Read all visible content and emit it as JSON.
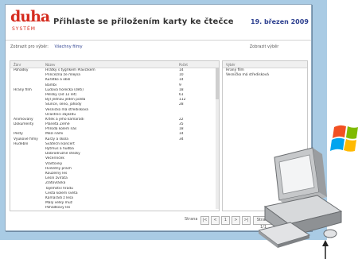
{
  "header": {
    "logo_text": "duha",
    "logo_sub": "SYSTÉM",
    "title": "Přihlaste se přiložením karty ke čtečce",
    "date": "19. březen 2009"
  },
  "toolbar": {
    "left_label": "Zobrazit pro výběr:",
    "left_link": "Všechny filmy",
    "right_label": "Zobrazit výběr"
  },
  "table": {
    "headers": {
      "genre": "Žánr",
      "title": "Název",
      "count": "Počet"
    },
    "rows": [
      {
        "genre": "Pohádky",
        "title": "Hrátky s tygříkem Plavčíkem",
        "count": "14"
      },
      {
        "genre": "",
        "title": "Princezna ze mlejna",
        "count": "10"
      },
      {
        "genre": "",
        "title": "Kuřátko a obilí",
        "count": "14"
      },
      {
        "genre": "",
        "title": "Bambi",
        "count": "9"
      },
      {
        "genre": "Hraný film",
        "title": "Ludová horečka (děti)",
        "count": "18"
      },
      {
        "genre": "",
        "title": "Pelíšky (od 12 let)",
        "count": "61"
      },
      {
        "genre": "",
        "title": "Byl jednou jeden polda",
        "count": "112"
      },
      {
        "genre": "",
        "title": "Slunce, seno, jahody",
        "count": "28"
      },
      {
        "genre": "",
        "title": "Vesničko má středisková",
        "count": ""
      },
      {
        "genre": "",
        "title": "Účastníci zájezdu",
        "count": ""
      },
      {
        "genre": "Animovaný",
        "title": "Krtek a jeho kamarádi",
        "count": "22"
      },
      {
        "genre": "Dokumenty",
        "title": "Planeta Země",
        "count": "35"
      },
      {
        "genre": "",
        "title": "Příroda kolem nás",
        "count": "18"
      },
      {
        "genre": "Pesty",
        "title": "Mezi námi",
        "count": "14"
      },
      {
        "genre": "Výukové filmy",
        "title": "Kurzy a škola",
        "count": "34"
      },
      {
        "genre": "Hudební",
        "title": "Sváteční koncert",
        "count": ""
      },
      {
        "genre": "",
        "title": "Rytmus a hudba",
        "count": ""
      },
      {
        "genre": "",
        "title": "Dobrodružné stezky",
        "count": ""
      },
      {
        "genre": "",
        "title": "Večerníček",
        "count": ""
      },
      {
        "genre": "",
        "title": "Vlaštovky",
        "count": ""
      },
      {
        "genre": "",
        "title": "Hvězdný prach",
        "count": ""
      },
      {
        "genre": "",
        "title": "Kouzelný les",
        "count": ""
      },
      {
        "genre": "",
        "title": "Lesní zvířata",
        "count": ""
      },
      {
        "genre": "",
        "title": "Zlatovláska",
        "count": ""
      },
      {
        "genre": "",
        "title": "Tajemství hradu",
        "count": ""
      },
      {
        "genre": "",
        "title": "Cesta kolem světa",
        "count": ""
      },
      {
        "genre": "",
        "title": "Kamarádi z lesa",
        "count": ""
      },
      {
        "genre": "",
        "title": "Malý velký muž",
        "count": ""
      },
      {
        "genre": "",
        "title": "Pohádkový les",
        "count": ""
      }
    ]
  },
  "side_panel": {
    "header": "Výběr",
    "items": [
      "Hraný film",
      "Vesničko má středisková"
    ]
  },
  "pager": {
    "label": "Strana",
    "buttons": [
      "|<",
      "<",
      "1",
      ">",
      ">|"
    ],
    "page_info": "Strana 1/1"
  },
  "colors": {
    "backdrop": "#a9cbe4",
    "brand_red": "#d52b1e",
    "accent_blue": "#2c3f8f"
  }
}
